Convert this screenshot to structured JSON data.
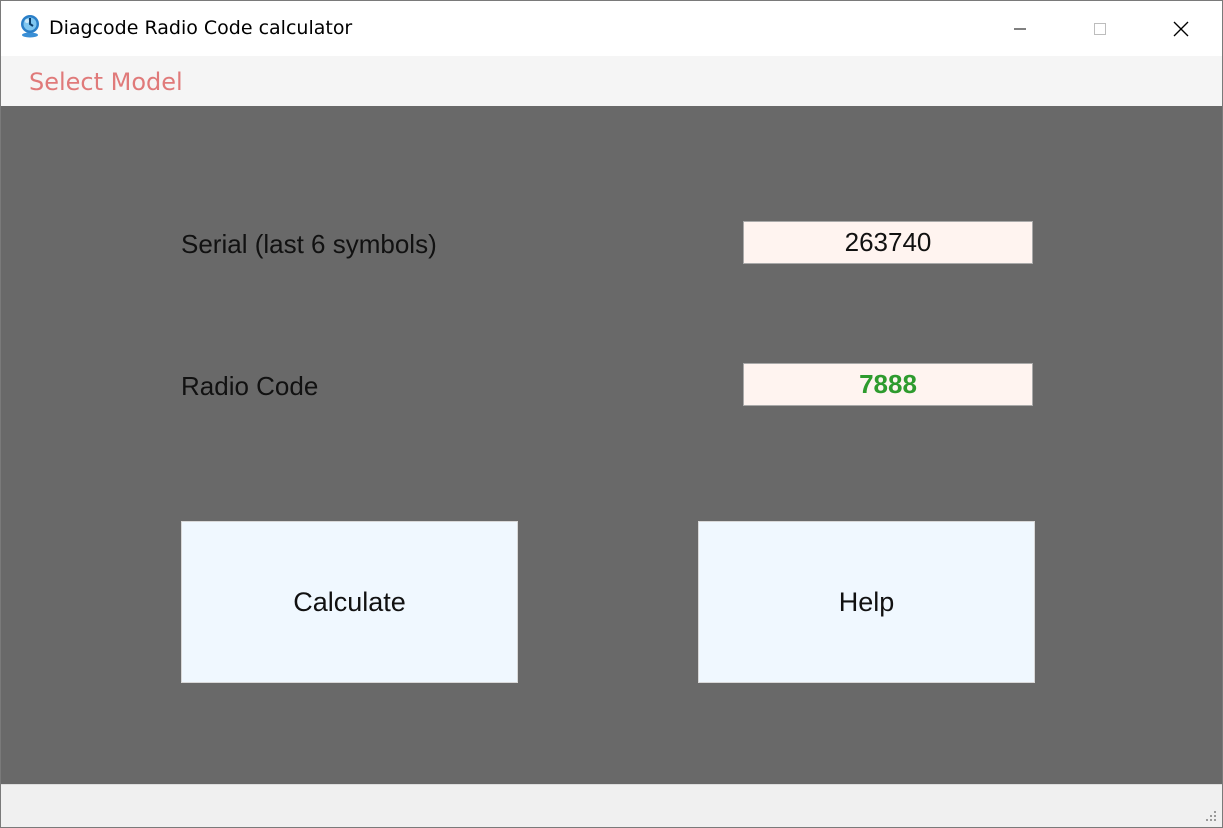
{
  "window": {
    "title": "Diagcode Radio Code calculator",
    "icons": {
      "app": "globe-app-icon",
      "minimize": "minimize-icon",
      "maximize": "maximize-icon",
      "close": "close-icon",
      "grip": "resize-grip-icon"
    }
  },
  "menu": {
    "items": [
      "Select Model"
    ]
  },
  "form": {
    "serial_label": "Serial (last 6 symbols)",
    "serial_value": "263740",
    "code_label": "Radio Code",
    "code_value": "7888"
  },
  "buttons": {
    "calculate": "Calculate",
    "help": "Help"
  },
  "colors": {
    "content_bg": "#696969",
    "menu_text": "#e07a7a",
    "field_bg": "#fff4f0",
    "code_text": "#2e9b2e",
    "button_bg": "#f0f8ff"
  }
}
